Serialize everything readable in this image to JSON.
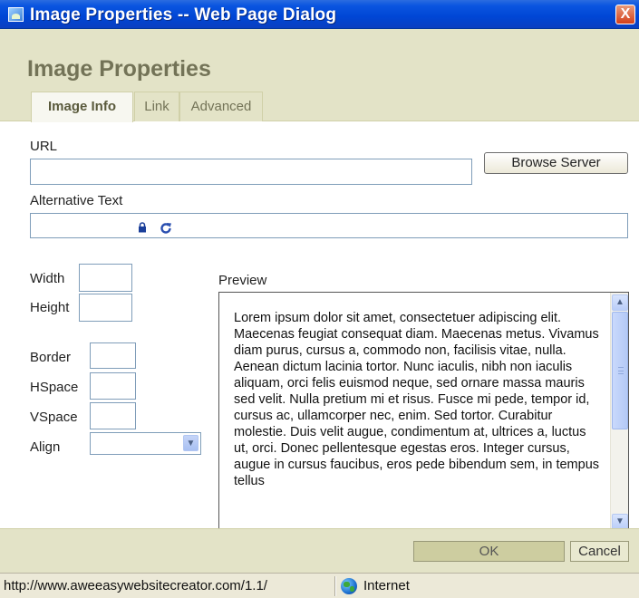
{
  "window": {
    "title": "Image Properties -- Web Page Dialog",
    "close_label": "X"
  },
  "dialog": {
    "title": "Image Properties",
    "tabs": [
      {
        "label": "Image Info",
        "active": true
      },
      {
        "label": "Link",
        "active": false
      },
      {
        "label": "Advanced",
        "active": false
      }
    ]
  },
  "form": {
    "url_label": "URL",
    "url_value": "",
    "browse_label": "Browse Server",
    "alt_label": "Alternative Text",
    "alt_value": "",
    "width_label": "Width",
    "width_value": "",
    "height_label": "Height",
    "height_value": "",
    "border_label": "Border",
    "border_value": "",
    "hspace_label": "HSpace",
    "hspace_value": "",
    "vspace_label": "VSpace",
    "vspace_value": "",
    "align_label": "Align",
    "align_value": ""
  },
  "preview": {
    "label": "Preview",
    "text": "Lorem ipsum dolor sit amet, consectetuer adipiscing elit. Maecenas feugiat consequat diam. Maecenas metus. Vivamus diam purus, cursus a, commodo non, facilisis vitae, nulla. Aenean dictum lacinia tortor. Nunc iaculis, nibh non iaculis aliquam, orci felis euismod neque, sed ornare massa mauris sed velit. Nulla pretium mi et risus. Fusce mi pede, tempor id, cursus ac, ullamcorper nec, enim. Sed tortor. Curabitur molestie. Duis velit augue, condimentum at, ultrices a, luctus ut, orci. Donec pellentesque egestas eros. Integer cursus, augue in cursus faucibus, eros pede bibendum sem, in tempus tellus"
  },
  "footer": {
    "ok_label": "OK",
    "cancel_label": "Cancel"
  },
  "statusbar": {
    "url": "http://www.aweeasywebsitecreator.com/1.1/",
    "zone": "Internet"
  },
  "colors": {
    "titlebar": "#0046d5",
    "band": "#e3e3c7",
    "title_text": "#737357",
    "ok_button": "#cdcda0"
  },
  "icons": [
    "window-icon",
    "close-icon",
    "lock-icon",
    "reset-size-icon",
    "dropdown-arrow-icon",
    "scroll-up-icon",
    "scroll-down-icon",
    "globe-icon"
  ]
}
